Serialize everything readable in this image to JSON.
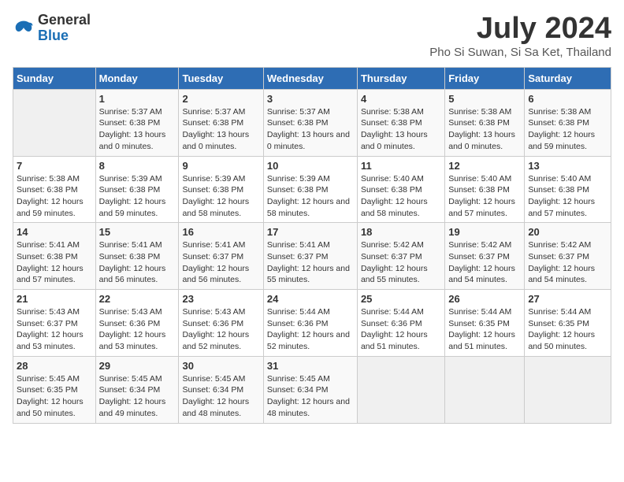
{
  "header": {
    "logo_line1": "General",
    "logo_line2": "Blue",
    "title": "July 2024",
    "subtitle": "Pho Si Suwan, Si Sa Ket, Thailand"
  },
  "days_of_week": [
    "Sunday",
    "Monday",
    "Tuesday",
    "Wednesday",
    "Thursday",
    "Friday",
    "Saturday"
  ],
  "weeks": [
    [
      {
        "day": "",
        "content": ""
      },
      {
        "day": "1",
        "content": "Sunrise: 5:37 AM\nSunset: 6:38 PM\nDaylight: 13 hours and 0 minutes."
      },
      {
        "day": "2",
        "content": "Sunrise: 5:37 AM\nSunset: 6:38 PM\nDaylight: 13 hours and 0 minutes."
      },
      {
        "day": "3",
        "content": "Sunrise: 5:37 AM\nSunset: 6:38 PM\nDaylight: 13 hours and 0 minutes."
      },
      {
        "day": "4",
        "content": "Sunrise: 5:38 AM\nSunset: 6:38 PM\nDaylight: 13 hours and 0 minutes."
      },
      {
        "day": "5",
        "content": "Sunrise: 5:38 AM\nSunset: 6:38 PM\nDaylight: 13 hours and 0 minutes."
      },
      {
        "day": "6",
        "content": "Sunrise: 5:38 AM\nSunset: 6:38 PM\nDaylight: 12 hours and 59 minutes."
      }
    ],
    [
      {
        "day": "7",
        "content": "Sunrise: 5:38 AM\nSunset: 6:38 PM\nDaylight: 12 hours and 59 minutes."
      },
      {
        "day": "8",
        "content": "Sunrise: 5:39 AM\nSunset: 6:38 PM\nDaylight: 12 hours and 59 minutes."
      },
      {
        "day": "9",
        "content": "Sunrise: 5:39 AM\nSunset: 6:38 PM\nDaylight: 12 hours and 58 minutes."
      },
      {
        "day": "10",
        "content": "Sunrise: 5:39 AM\nSunset: 6:38 PM\nDaylight: 12 hours and 58 minutes."
      },
      {
        "day": "11",
        "content": "Sunrise: 5:40 AM\nSunset: 6:38 PM\nDaylight: 12 hours and 58 minutes."
      },
      {
        "day": "12",
        "content": "Sunrise: 5:40 AM\nSunset: 6:38 PM\nDaylight: 12 hours and 57 minutes."
      },
      {
        "day": "13",
        "content": "Sunrise: 5:40 AM\nSunset: 6:38 PM\nDaylight: 12 hours and 57 minutes."
      }
    ],
    [
      {
        "day": "14",
        "content": "Sunrise: 5:41 AM\nSunset: 6:38 PM\nDaylight: 12 hours and 57 minutes."
      },
      {
        "day": "15",
        "content": "Sunrise: 5:41 AM\nSunset: 6:38 PM\nDaylight: 12 hours and 56 minutes."
      },
      {
        "day": "16",
        "content": "Sunrise: 5:41 AM\nSunset: 6:37 PM\nDaylight: 12 hours and 56 minutes."
      },
      {
        "day": "17",
        "content": "Sunrise: 5:41 AM\nSunset: 6:37 PM\nDaylight: 12 hours and 55 minutes."
      },
      {
        "day": "18",
        "content": "Sunrise: 5:42 AM\nSunset: 6:37 PM\nDaylight: 12 hours and 55 minutes."
      },
      {
        "day": "19",
        "content": "Sunrise: 5:42 AM\nSunset: 6:37 PM\nDaylight: 12 hours and 54 minutes."
      },
      {
        "day": "20",
        "content": "Sunrise: 5:42 AM\nSunset: 6:37 PM\nDaylight: 12 hours and 54 minutes."
      }
    ],
    [
      {
        "day": "21",
        "content": "Sunrise: 5:43 AM\nSunset: 6:37 PM\nDaylight: 12 hours and 53 minutes."
      },
      {
        "day": "22",
        "content": "Sunrise: 5:43 AM\nSunset: 6:36 PM\nDaylight: 12 hours and 53 minutes."
      },
      {
        "day": "23",
        "content": "Sunrise: 5:43 AM\nSunset: 6:36 PM\nDaylight: 12 hours and 52 minutes."
      },
      {
        "day": "24",
        "content": "Sunrise: 5:44 AM\nSunset: 6:36 PM\nDaylight: 12 hours and 52 minutes."
      },
      {
        "day": "25",
        "content": "Sunrise: 5:44 AM\nSunset: 6:36 PM\nDaylight: 12 hours and 51 minutes."
      },
      {
        "day": "26",
        "content": "Sunrise: 5:44 AM\nSunset: 6:35 PM\nDaylight: 12 hours and 51 minutes."
      },
      {
        "day": "27",
        "content": "Sunrise: 5:44 AM\nSunset: 6:35 PM\nDaylight: 12 hours and 50 minutes."
      }
    ],
    [
      {
        "day": "28",
        "content": "Sunrise: 5:45 AM\nSunset: 6:35 PM\nDaylight: 12 hours and 50 minutes."
      },
      {
        "day": "29",
        "content": "Sunrise: 5:45 AM\nSunset: 6:34 PM\nDaylight: 12 hours and 49 minutes."
      },
      {
        "day": "30",
        "content": "Sunrise: 5:45 AM\nSunset: 6:34 PM\nDaylight: 12 hours and 48 minutes."
      },
      {
        "day": "31",
        "content": "Sunrise: 5:45 AM\nSunset: 6:34 PM\nDaylight: 12 hours and 48 minutes."
      },
      {
        "day": "",
        "content": ""
      },
      {
        "day": "",
        "content": ""
      },
      {
        "day": "",
        "content": ""
      }
    ]
  ]
}
